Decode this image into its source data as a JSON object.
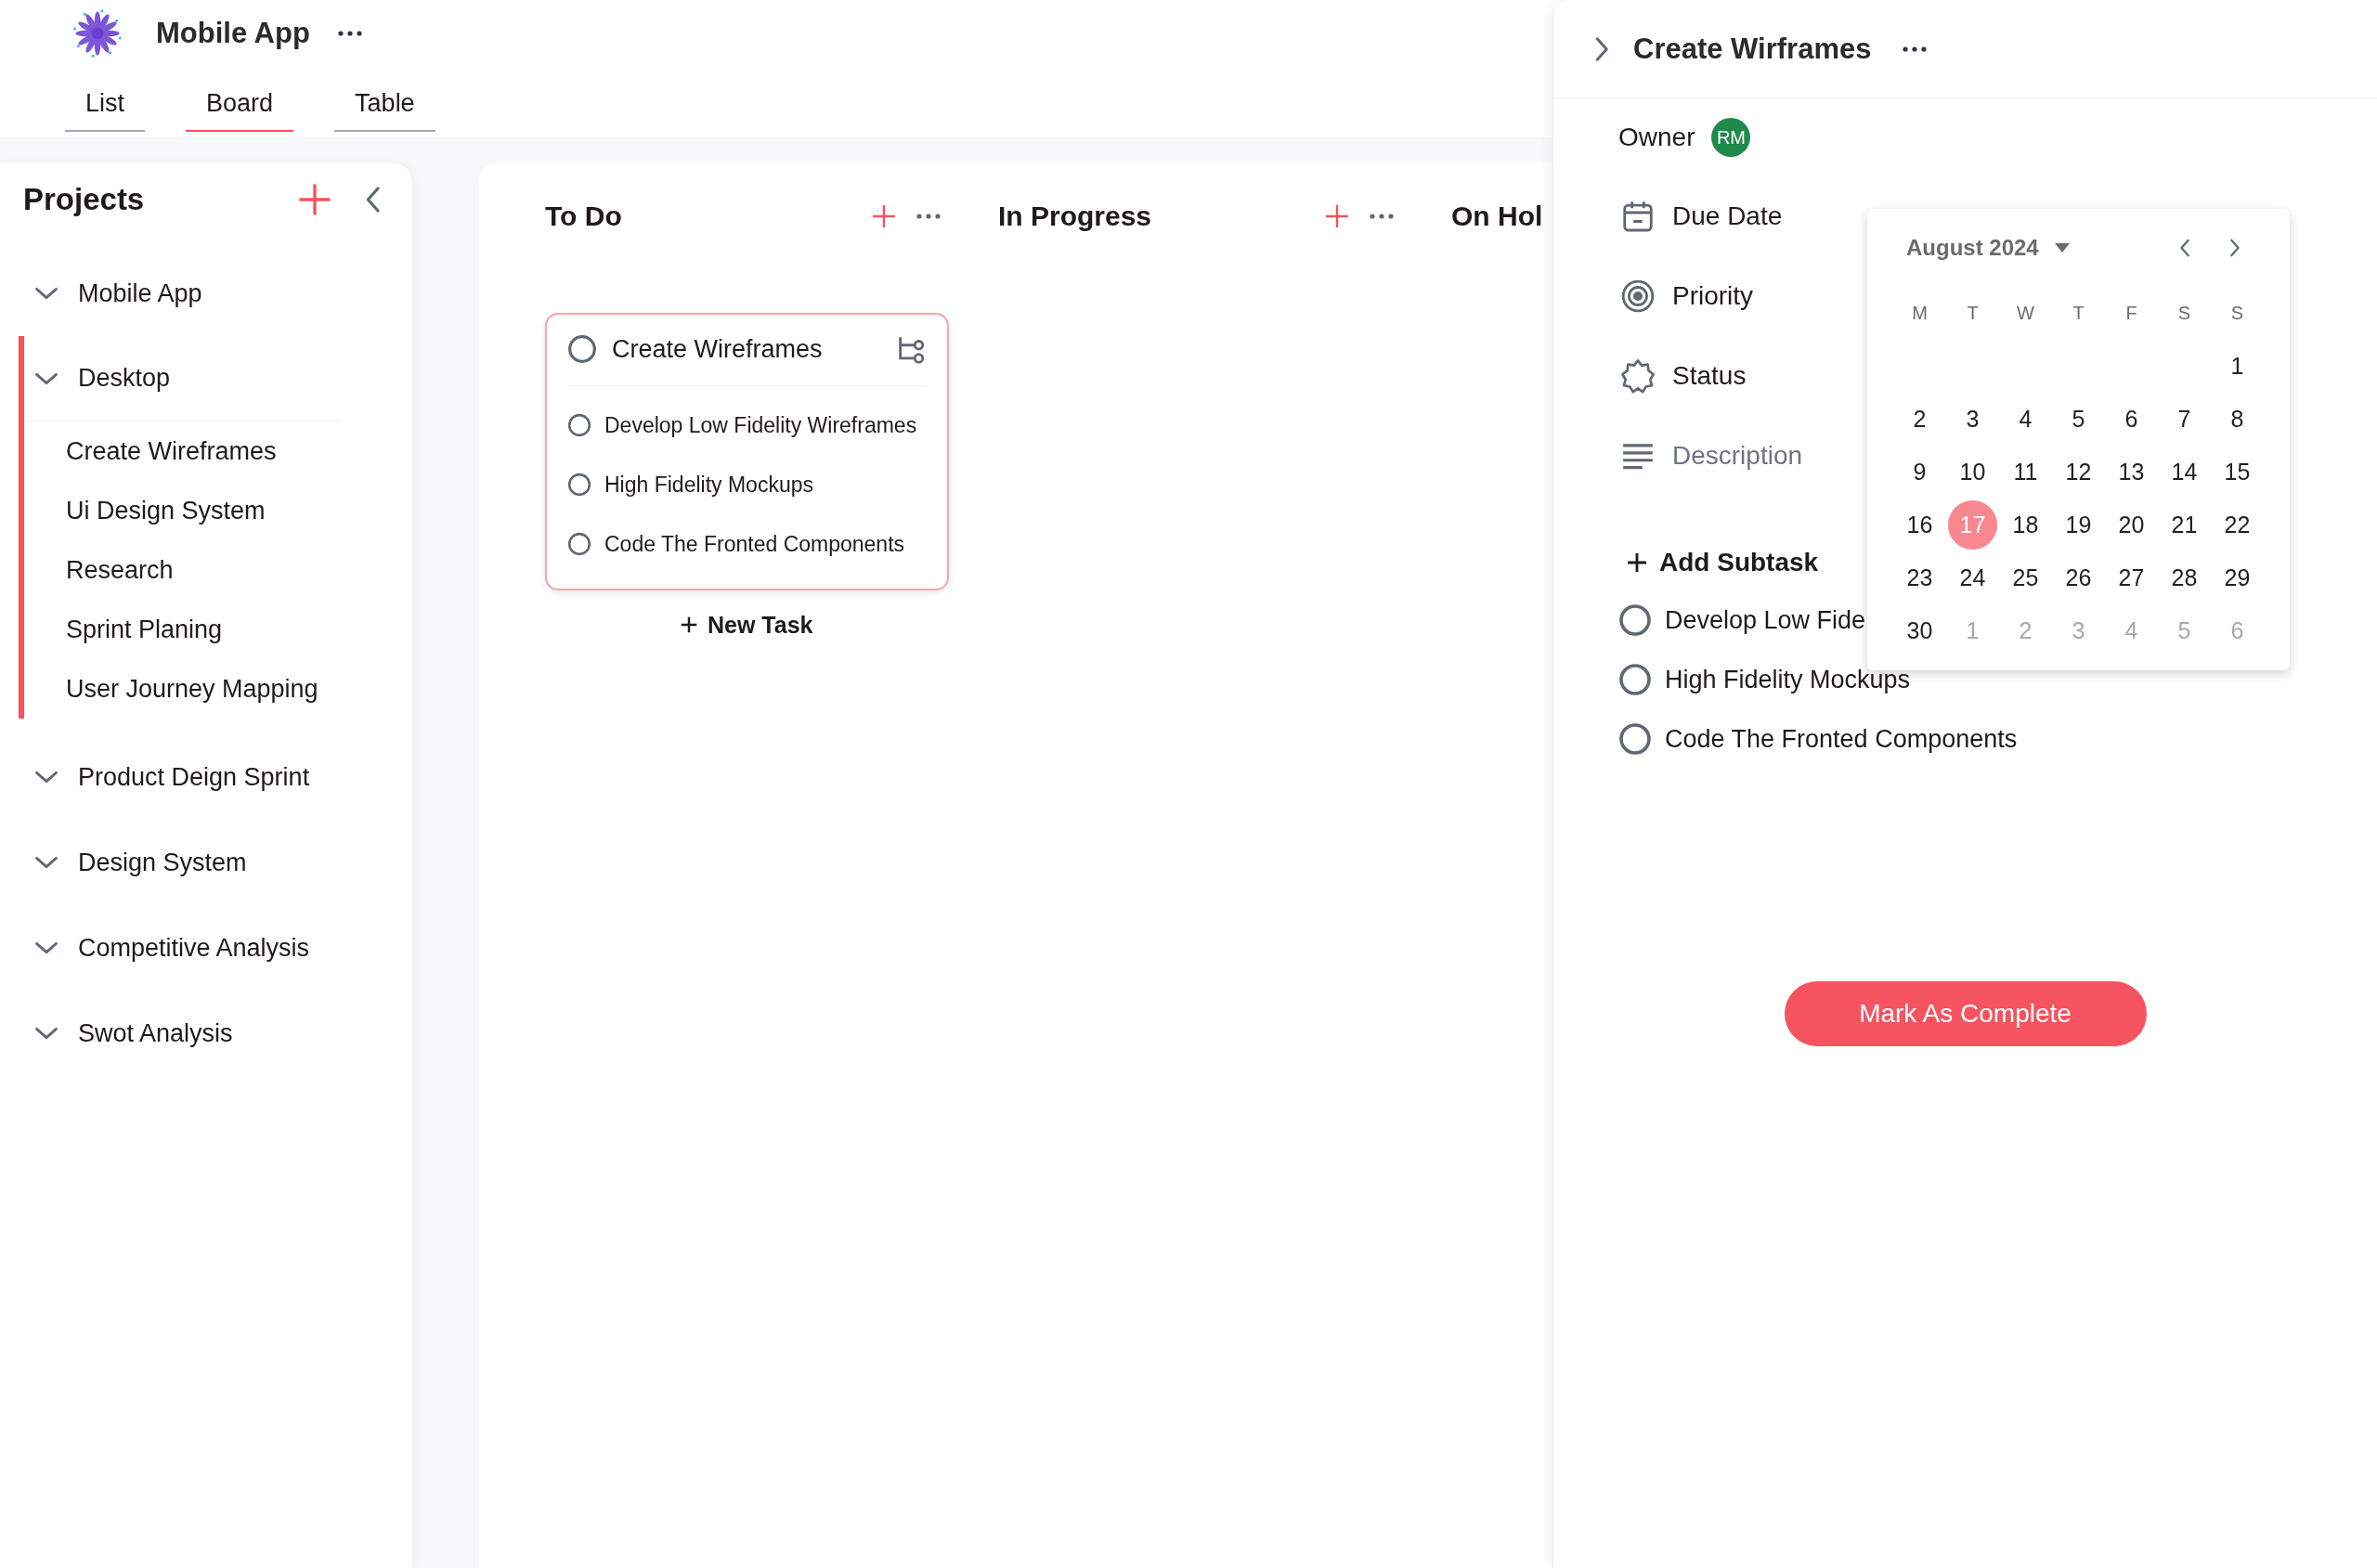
{
  "app": {
    "title": "Mobile App"
  },
  "tabs": [
    {
      "label": "List",
      "selected": false
    },
    {
      "label": "Board",
      "selected": true
    },
    {
      "label": "Table",
      "selected": false
    }
  ],
  "sidebar": {
    "title": "Projects",
    "projects": [
      {
        "label": "Mobile App",
        "selected": false
      },
      {
        "label": "Desktop",
        "selected": true,
        "children": [
          {
            "label": "Create Wireframes"
          },
          {
            "label": "Ui Design System"
          },
          {
            "label": "Research"
          },
          {
            "label": "Sprint Planing"
          },
          {
            "label": "User Journey Mapping"
          }
        ]
      },
      {
        "label": "Product Deign Sprint",
        "selected": false
      },
      {
        "label": "Design System",
        "selected": false
      },
      {
        "label": "Competitive Analysis",
        "selected": false
      },
      {
        "label": "Swot Analysis",
        "selected": false
      }
    ]
  },
  "board": {
    "columns": [
      {
        "title": "To Do",
        "actions": true,
        "cards": [
          {
            "title": "Create Wireframes",
            "checked": false,
            "subtasks": [
              {
                "label": "Develop Low Fidelity Wireframes",
                "checked": false
              },
              {
                "label": "High Fidelity Mockups",
                "checked": false
              },
              {
                "label": "Code The Fronted Components",
                "checked": false
              }
            ]
          }
        ],
        "new_task": "New Task"
      },
      {
        "title": "In Progress",
        "actions": true
      },
      {
        "title": "On Hol"
      }
    ]
  },
  "detail": {
    "title": "Create Wirframes",
    "owner": {
      "label": "Owner",
      "initials": "RM"
    },
    "fields": [
      {
        "kind": "due_date",
        "label": "Due Date"
      },
      {
        "kind": "priority",
        "label": "Priority"
      },
      {
        "kind": "status",
        "label": "Status"
      },
      {
        "kind": "description",
        "placeholder": "Description"
      }
    ],
    "add_subtask": "Add Subtask",
    "subtasks": [
      {
        "label": "Develop Low Fide",
        "checked": false
      },
      {
        "label": "High Fidelity Mockups",
        "checked": false
      },
      {
        "label": "Code The Fronted Components",
        "checked": false
      }
    ],
    "complete_button": "Mark As Complete"
  },
  "calendar": {
    "month": "August 2024",
    "weekdays": [
      "M",
      "T",
      "W",
      "T",
      "F",
      "S",
      "S"
    ],
    "weeks": [
      [
        {
          "label": "1",
          "selected": false,
          "outside": false
        }
      ],
      [
        {
          "label": "2",
          "selected": false,
          "outside": false
        },
        {
          "label": "3",
          "selected": false,
          "outside": false
        },
        {
          "label": "4",
          "selected": false,
          "outside": false
        },
        {
          "label": "5",
          "selected": false,
          "outside": false
        },
        {
          "label": "6",
          "selected": false,
          "outside": false
        },
        {
          "label": "7",
          "selected": false,
          "outside": false
        },
        {
          "label": "8",
          "selected": false,
          "outside": false
        }
      ],
      [
        {
          "label": "9",
          "selected": false,
          "outside": false
        },
        {
          "label": "10",
          "selected": false,
          "outside": false
        },
        {
          "label": "11",
          "selected": false,
          "outside": false
        },
        {
          "label": "12",
          "selected": false,
          "outside": false
        },
        {
          "label": "13",
          "selected": false,
          "outside": false
        },
        {
          "label": "14",
          "selected": false,
          "outside": false
        },
        {
          "label": "15",
          "selected": false,
          "outside": false
        }
      ],
      [
        {
          "label": "16",
          "selected": false,
          "outside": false
        },
        {
          "label": "17",
          "selected": true,
          "outside": false
        },
        {
          "label": "18",
          "selected": false,
          "outside": false
        },
        {
          "label": "19",
          "selected": false,
          "outside": false
        },
        {
          "label": "20",
          "selected": false,
          "outside": false
        },
        {
          "label": "21",
          "selected": false,
          "outside": false
        },
        {
          "label": "22",
          "selected": false,
          "outside": false
        }
      ],
      [
        {
          "label": "23",
          "selected": false,
          "outside": false
        },
        {
          "label": "24",
          "selected": false,
          "outside": false
        },
        {
          "label": "25",
          "selected": false,
          "outside": false
        },
        {
          "label": "26",
          "selected": false,
          "outside": false
        },
        {
          "label": "27",
          "selected": false,
          "outside": false
        },
        {
          "label": "28",
          "selected": false,
          "outside": false
        },
        {
          "label": "29",
          "selected": false,
          "outside": false
        }
      ],
      [
        {
          "label": "30",
          "selected": false,
          "outside": false
        },
        {
          "label": "1",
          "selected": false,
          "outside": true
        },
        {
          "label": "2",
          "selected": false,
          "outside": true
        },
        {
          "label": "3",
          "selected": false,
          "outside": true
        },
        {
          "label": "4",
          "selected": false,
          "outside": true
        },
        {
          "label": "5",
          "selected": false,
          "outside": true
        },
        {
          "label": "6",
          "selected": false,
          "outside": true
        }
      ]
    ]
  }
}
